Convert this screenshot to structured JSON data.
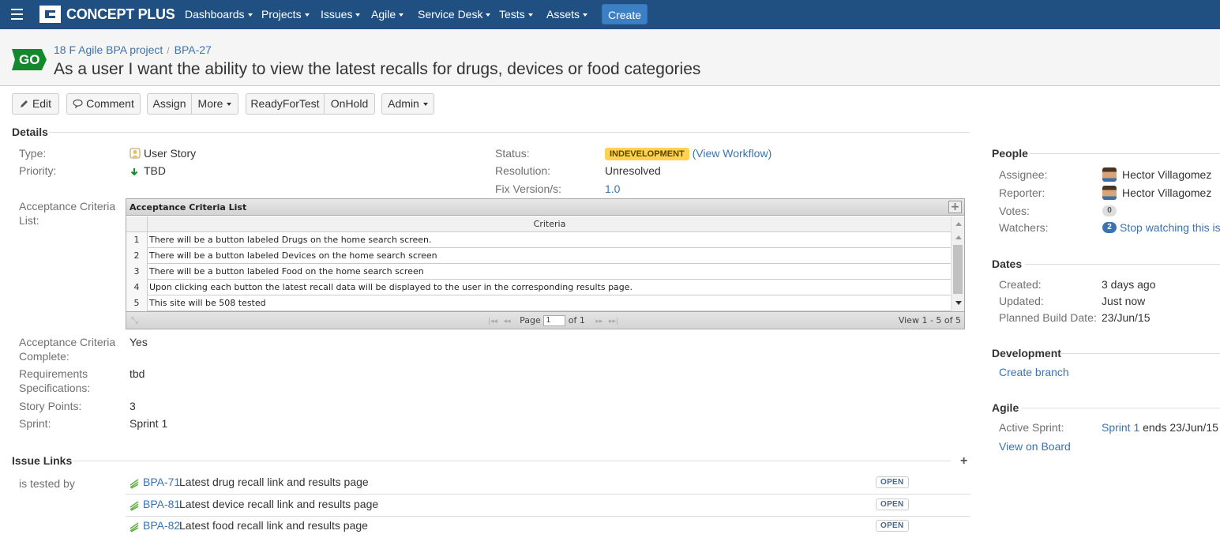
{
  "nav": {
    "brand": "CONCEPT PLUS",
    "items": [
      "Dashboards",
      "Projects",
      "Issues",
      "Agile",
      "Service Desk",
      "Tests",
      "Assets"
    ],
    "create_label": "Create"
  },
  "header": {
    "badge": "GO",
    "project": "18 F Agile BPA project",
    "issue_key": "BPA-27",
    "title": "As a user I want the ability to view the latest recalls for drugs, devices or food categories"
  },
  "toolbar": {
    "edit": "Edit",
    "comment": "Comment",
    "assign": "Assign",
    "more": "More",
    "ready_for_test": "ReadyForTest",
    "on_hold": "OnHold",
    "admin": "Admin"
  },
  "details": {
    "heading": "Details",
    "type_label": "Type:",
    "type_value": "User Story",
    "priority_label": "Priority:",
    "priority_value": "TBD",
    "status_label": "Status:",
    "status_value": "INDEVELOPMENT",
    "view_workflow": "(View Workflow)",
    "resolution_label": "Resolution:",
    "resolution_value": "Unresolved",
    "fix_version_label": "Fix Version/s:",
    "fix_version_value": "1.0",
    "acceptance_list_label_1": "Acceptance Criteria",
    "acceptance_list_label_2": "List:",
    "acceptance_complete_label_1": "Acceptance Criteria",
    "acceptance_complete_label_2": "Complete:",
    "acceptance_complete_value": "Yes",
    "requirements_label_1": "Requirements",
    "requirements_label_2": "Specifications:",
    "requirements_value": "tbd",
    "story_points_label": "Story Points:",
    "story_points_value": "3",
    "sprint_label": "Sprint:",
    "sprint_value": "Sprint 1"
  },
  "criteria_grid": {
    "caption": "Acceptance Criteria List",
    "column": "Criteria",
    "rows": [
      {
        "n": "1",
        "text": "There will be a button labeled Drugs on the home search screen."
      },
      {
        "n": "2",
        "text": "There will be a button labeled Devices on the home search screen"
      },
      {
        "n": "3",
        "text": "There will be a button labeled Food on the home search screen"
      },
      {
        "n": "4",
        "text": "Upon clicking each button the latest recall data will be displayed to the user in the corresponding results page."
      },
      {
        "n": "5",
        "text": "This site will be 508 tested"
      }
    ],
    "page_label": "Page",
    "page_value": "1",
    "of_label": "of 1",
    "view_count": "View 1 - 5 of 5"
  },
  "issue_links": {
    "heading": "Issue Links",
    "relation": "is tested by",
    "items": [
      {
        "key": "BPA-71",
        "summary": "Latest drug recall link and results page",
        "status": "OPEN"
      },
      {
        "key": "BPA-81",
        "summary": "Latest device recall link and results page",
        "status": "OPEN"
      },
      {
        "key": "BPA-82",
        "summary": "Latest food recall link and results page",
        "status": "OPEN"
      }
    ]
  },
  "people": {
    "heading": "People",
    "assignee_label": "Assignee:",
    "assignee": "Hector Villagomez",
    "reporter_label": "Reporter:",
    "reporter": "Hector Villagomez",
    "votes_label": "Votes:",
    "votes": "0",
    "watchers_label": "Watchers:",
    "watchers": "2",
    "watch_action": "Stop watching this issue"
  },
  "dates": {
    "heading": "Dates",
    "created_label": "Created:",
    "created": "3 days ago",
    "updated_label": "Updated:",
    "updated": "Just now",
    "planned_label": "Planned Build Date:",
    "planned": "23/Jun/15"
  },
  "development": {
    "heading": "Development",
    "create_branch": "Create branch"
  },
  "agile": {
    "heading": "Agile",
    "active_sprint_label": "Active Sprint:",
    "sprint_link": "Sprint 1",
    "sprint_end": "ends 23/Jun/15",
    "view_on_board": "View on Board"
  },
  "colors": {
    "nav_bg": "#205081",
    "link": "#3b73af",
    "status_yellow": "#ffd351",
    "go_green": "#14892c"
  }
}
